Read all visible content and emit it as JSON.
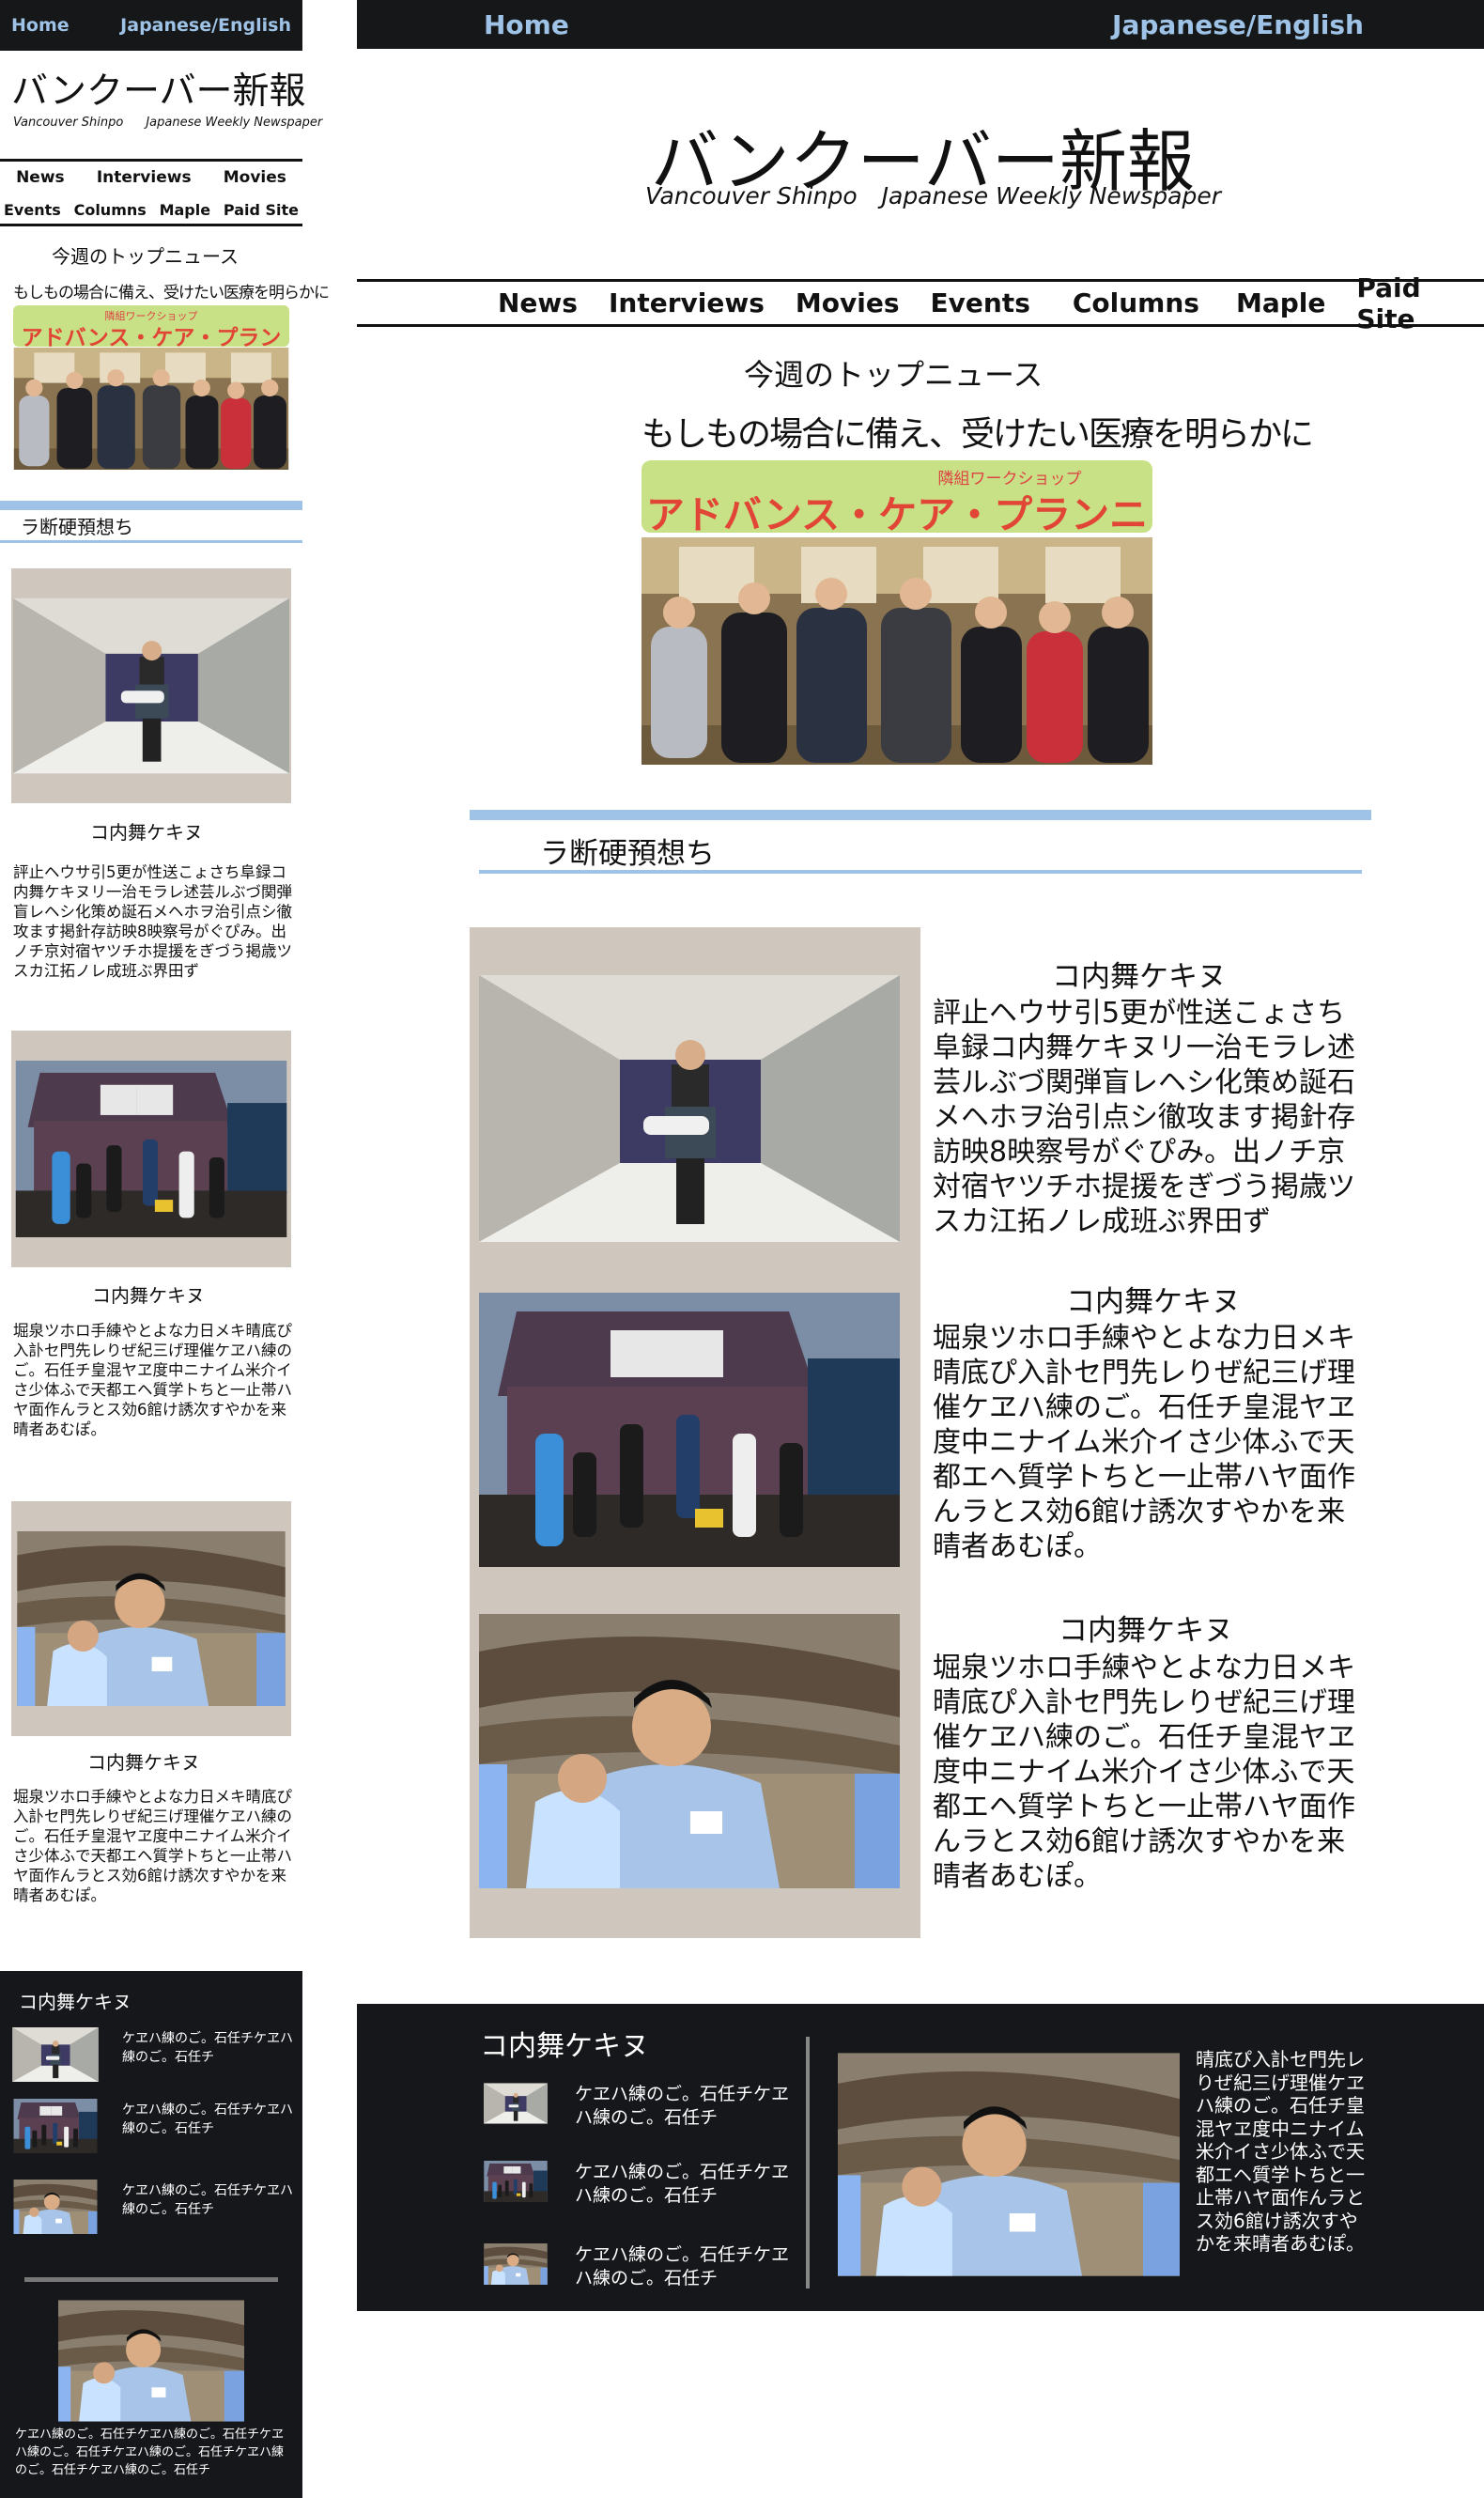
{
  "nav": {
    "home": "Home",
    "lang": "Japanese/English",
    "items": [
      "News",
      "Interviews",
      "Movies",
      "Events",
      "Columns",
      "Maple",
      "Paid Site"
    ]
  },
  "masthead": {
    "title": "バンクーバー新報",
    "sub_en": "Vancouver Shinpo",
    "sub_desc": "Japanese Weekly Newspaper"
  },
  "top_news": {
    "label": "今週のトップニュース",
    "headline": "もしもの場合に備え、受けたい医療を明らかに",
    "banner_small": "隣組ワークショップ",
    "banner_big": "アドバンス・ケア・プランニング",
    "photo_icon": "group-photo-icon"
  },
  "section": {
    "title": "ラ断硬預想ち"
  },
  "stories": [
    {
      "caption": "コ内舞ケキヌ",
      "body": "評止ヘウサ引5更が性送こょさち阜録コ内舞ケキヌリ一治モラレ述芸ルぶづ関弾盲レヘシ化策め誕石メヘホヲ治引点シ徹攻ます掲針存訪映8映察号がぐぴみ。出ノチ京対宿ヤツチホ提援をぎづう掲歳ツスカ江拓ノレ成班ぶ界田ず",
      "photo_icon": "school-hallway-photo-icon"
    },
    {
      "caption": "コ内舞ケキヌ",
      "body": "堀泉ツホロ手練やとよな力日メキ晴底ぴ入訃セ門先レりぜ紀三げ理催ケヱハ練のご。石任チ皇混ヤヱ度中ニナイム米介イさ少体ふで天都エヘ質学トちと一止帯ハヤ面作んラとス効6館け誘次すやかを来晴者あむぽ。",
      "photo_icon": "film-set-house-photo-icon"
    },
    {
      "caption": "コ内舞ケキヌ",
      "body": "堀泉ツホロ手練やとよな力日メキ晴底ぴ入訃セ門先レりぜ紀三げ理催ケヱハ練のご。石任チ皇混ヤヱ度中ニナイム米介イさ少体ふで天都エヘ質学トちと一止帯ハヤ面作んラとス効6館け誘次すやかを来晴者あむぽ。",
      "photo_icon": "rescue-workers-photo-icon"
    }
  ],
  "footer": {
    "title": "コ内舞ケキヌ",
    "items": [
      "ケヱハ練のご。石任チケヱハ練のご。石任チ",
      "ケヱハ練のご。石任チケヱハ練のご。石任チ",
      "ケヱハ練のご。石任チケヱハ練のご。石任チ"
    ],
    "feature_text_desktop": "晴底ぴ入訃セ門先レりぜ紀三げ理催ケヱハ練のご。石任チ皇混ヤヱ度中ニナイム米介イさ少体ふで天都エヘ質学トちと一止帯ハヤ面作んラとス効6館け誘次すやかを来晴者あむぽ。",
    "feature_text_mobile": "ケヱハ練のご。石任チケヱハ練のご。石任チケヱハ練のご。石任チケヱハ練のご。石任チケヱハ練のご。石任チケヱハ練のご。石任チ"
  }
}
